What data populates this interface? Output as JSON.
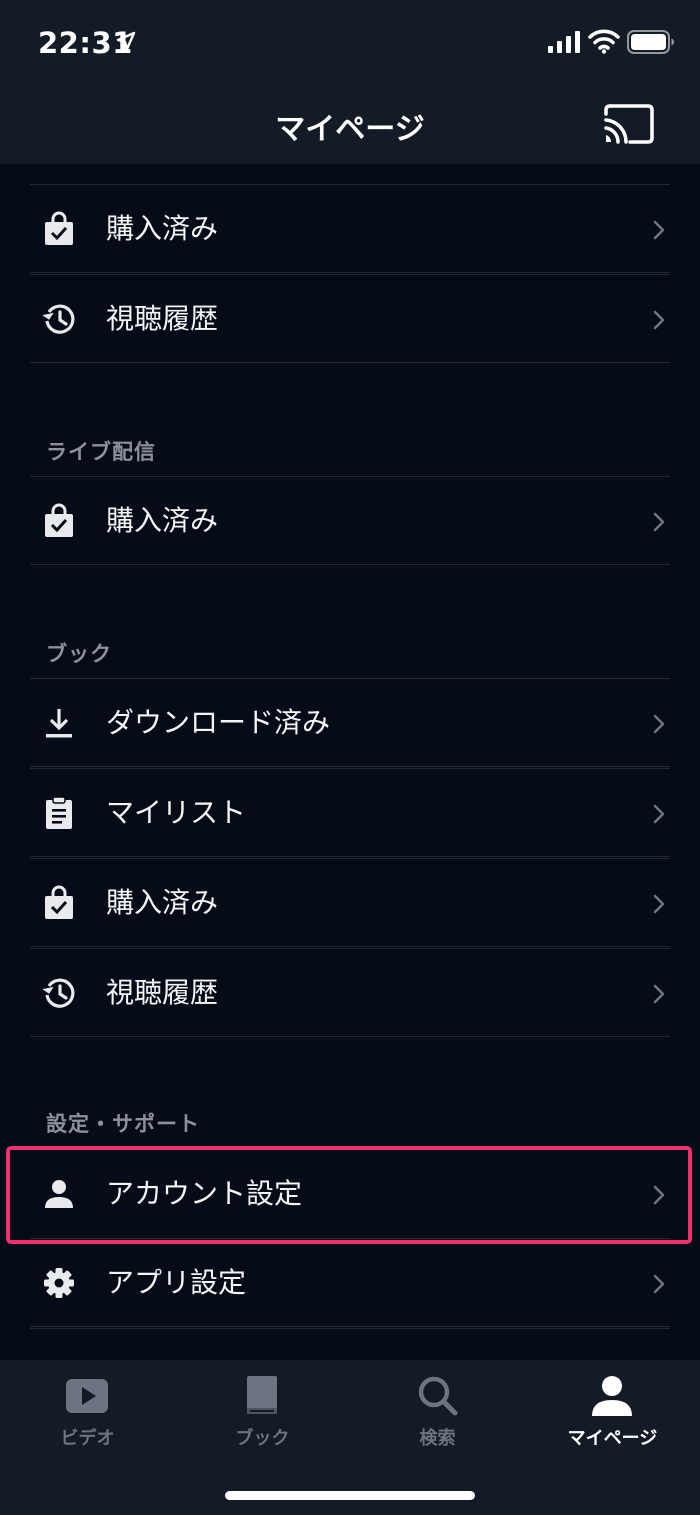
{
  "status": {
    "time": "22:31"
  },
  "header": {
    "title": "マイページ"
  },
  "sections": {
    "video": {
      "items": [
        {
          "label": "購入済み",
          "icon": "shopping-bag-check-icon"
        },
        {
          "label": "視聴履歴",
          "icon": "history-icon"
        }
      ]
    },
    "live": {
      "heading": "ライブ配信",
      "items": [
        {
          "label": "購入済み",
          "icon": "shopping-bag-check-icon"
        }
      ]
    },
    "book": {
      "heading": "ブック",
      "items": [
        {
          "label": "ダウンロード済み",
          "icon": "download-icon"
        },
        {
          "label": "マイリスト",
          "icon": "clipboard-list-icon"
        },
        {
          "label": "購入済み",
          "icon": "shopping-bag-check-icon"
        },
        {
          "label": "視聴履歴",
          "icon": "history-icon"
        }
      ]
    },
    "settings": {
      "heading": "設定・サポート",
      "items": [
        {
          "label": "アカウント設定",
          "icon": "person-icon"
        },
        {
          "label": "アプリ設定",
          "icon": "gear-icon"
        }
      ]
    }
  },
  "tabs": [
    {
      "label": "ビデオ",
      "icon": "play-icon",
      "active": false
    },
    {
      "label": "ブック",
      "icon": "book-icon",
      "active": false
    },
    {
      "label": "検索",
      "icon": "search-icon",
      "active": false
    },
    {
      "label": "マイページ",
      "icon": "person-icon",
      "active": true
    }
  ],
  "colors": {
    "background": "#050c17",
    "bar": "#121b26",
    "highlight": "#f0306a",
    "muted": "#8a929d"
  }
}
